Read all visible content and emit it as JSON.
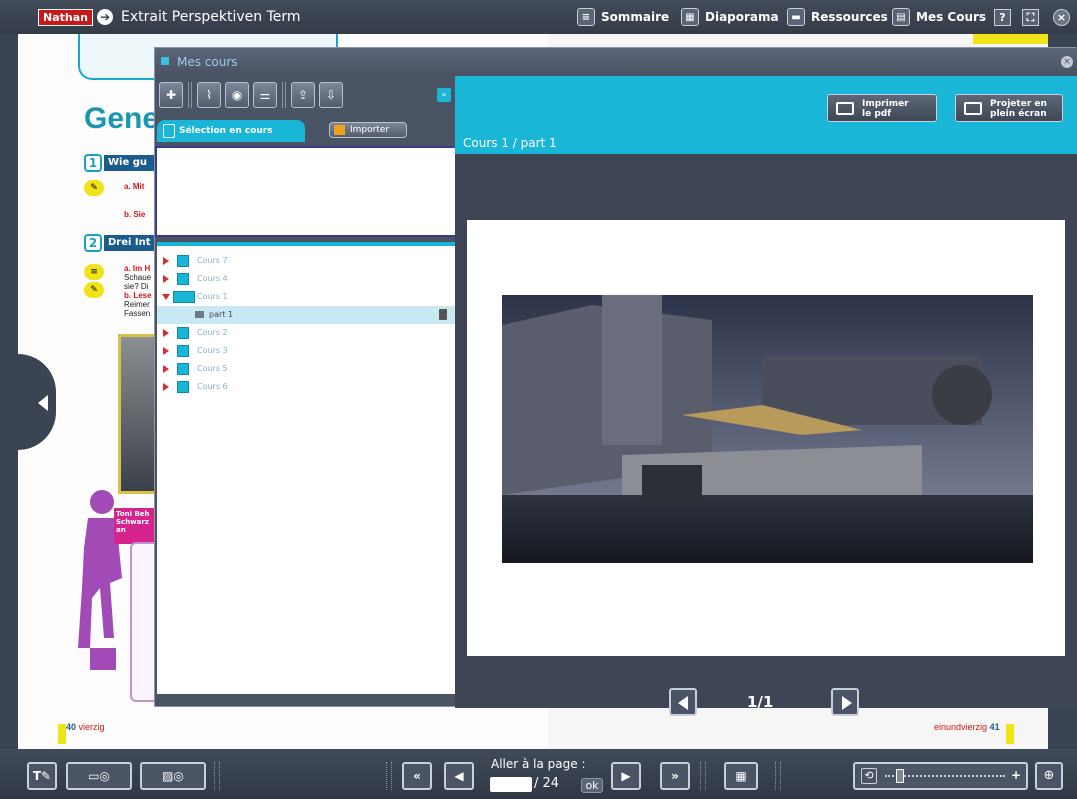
{
  "topbar": {
    "logo": "Nathan",
    "title": "Extrait Perspektiven Term",
    "menu": [
      {
        "label": "Sommaire",
        "icon": "list-icon"
      },
      {
        "label": "Diaporama",
        "icon": "grid-icon"
      },
      {
        "label": "Ressources",
        "icon": "folder-icon"
      },
      {
        "label": "Mes Cours",
        "icon": "slides-icon"
      }
    ],
    "help": "?",
    "close": "×"
  },
  "book": {
    "title": "Gene",
    "section1": {
      "num": "1",
      "title": "Wie gu"
    },
    "section2": {
      "num": "2",
      "title": "Drei Int"
    },
    "text_a1": "a. Mit",
    "text_b1": "b. Sie",
    "text_a2": "a. Im H",
    "lines2": [
      "Schaue",
      "sie? Di",
      "b. Lese",
      "Reimer",
      "Fassen"
    ],
    "pink_title": "Toni Beh",
    "pink_sub": "Schwarz an",
    "left_page_num": "40",
    "left_page_word": "vierzig",
    "right_page_word": "einundvierzig",
    "right_page_num": "41"
  },
  "modal": {
    "title": "Mes cours",
    "close": "×",
    "tab_label": "Sélection en cours",
    "import_label": "Importer",
    "collapse": "«",
    "tree": [
      {
        "label": "Cours 7",
        "expanded": false
      },
      {
        "label": "Cours 4",
        "expanded": false
      },
      {
        "label": "Cours 1",
        "expanded": true
      },
      {
        "label": "part 1",
        "child": true
      },
      {
        "label": "Cours 2",
        "expanded": false
      },
      {
        "label": "Cours 3",
        "expanded": false
      },
      {
        "label": "Cours 5",
        "expanded": false
      },
      {
        "label": "Cours 6",
        "expanded": false
      }
    ],
    "print_btn": [
      "Imprimer",
      "le pdf"
    ],
    "project_btn": [
      "Projeter en",
      "plein écran"
    ],
    "breadcrumb": "Cours 1 / part 1",
    "pager_text": "1/1"
  },
  "bottombar": {
    "goto_label": "Aller à la page :",
    "goto_value": "",
    "goto_total": "/ 24",
    "ok_label": "ok",
    "zoom_level": 0.1
  },
  "colors": {
    "accent": "#1ab6d8",
    "dark": "#3e4656",
    "brand_red": "#c81818"
  }
}
